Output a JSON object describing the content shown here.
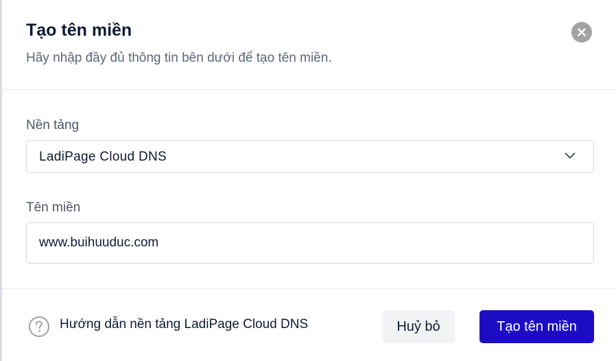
{
  "dialog": {
    "title": "Tạo tên miền",
    "subtitle": "Hãy nhập đầy đủ thông tin bên dưới để tạo tên miền."
  },
  "form": {
    "platform": {
      "label": "Nền tảng",
      "selected": "LadiPage Cloud DNS"
    },
    "domain": {
      "label": "Tên miền",
      "value": "www.buihuuduc.com"
    }
  },
  "footer": {
    "help_text": "Hướng dẫn nền tảng LadiPage Cloud DNS",
    "cancel_label": "Huỷ bỏ",
    "submit_label": "Tạo tên miền"
  },
  "icons": {
    "close": "close-icon",
    "chevron": "chevron-down-icon",
    "help": "question-circle-icon"
  },
  "colors": {
    "primary": "#1c0dc5",
    "title_text": "#0e1a33",
    "close_bg": "#a3a3a3"
  }
}
